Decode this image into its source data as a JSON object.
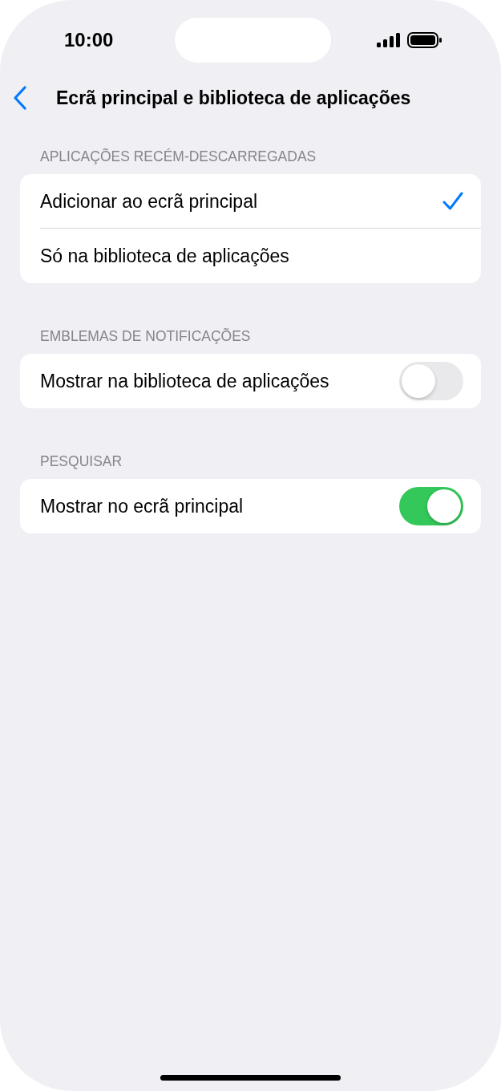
{
  "status_bar": {
    "time": "10:00"
  },
  "nav": {
    "title": "Ecrã principal e biblioteca de aplicações"
  },
  "sections": [
    {
      "header": "APLICAÇÕES RECÉM-DESCARREGADAS",
      "rows": [
        {
          "kind": "choice",
          "label": "Adicionar ao ecrã principal",
          "selected": true
        },
        {
          "kind": "choice",
          "label": "Só na biblioteca de aplicações",
          "selected": false
        }
      ]
    },
    {
      "header": "EMBLEMAS DE NOTIFICAÇÕES",
      "rows": [
        {
          "kind": "toggle",
          "label": "Mostrar na biblioteca de aplicações",
          "on": false
        }
      ]
    },
    {
      "header": "PESQUISAR",
      "rows": [
        {
          "kind": "toggle",
          "label": "Mostrar no ecrã principal",
          "on": true
        }
      ]
    }
  ]
}
